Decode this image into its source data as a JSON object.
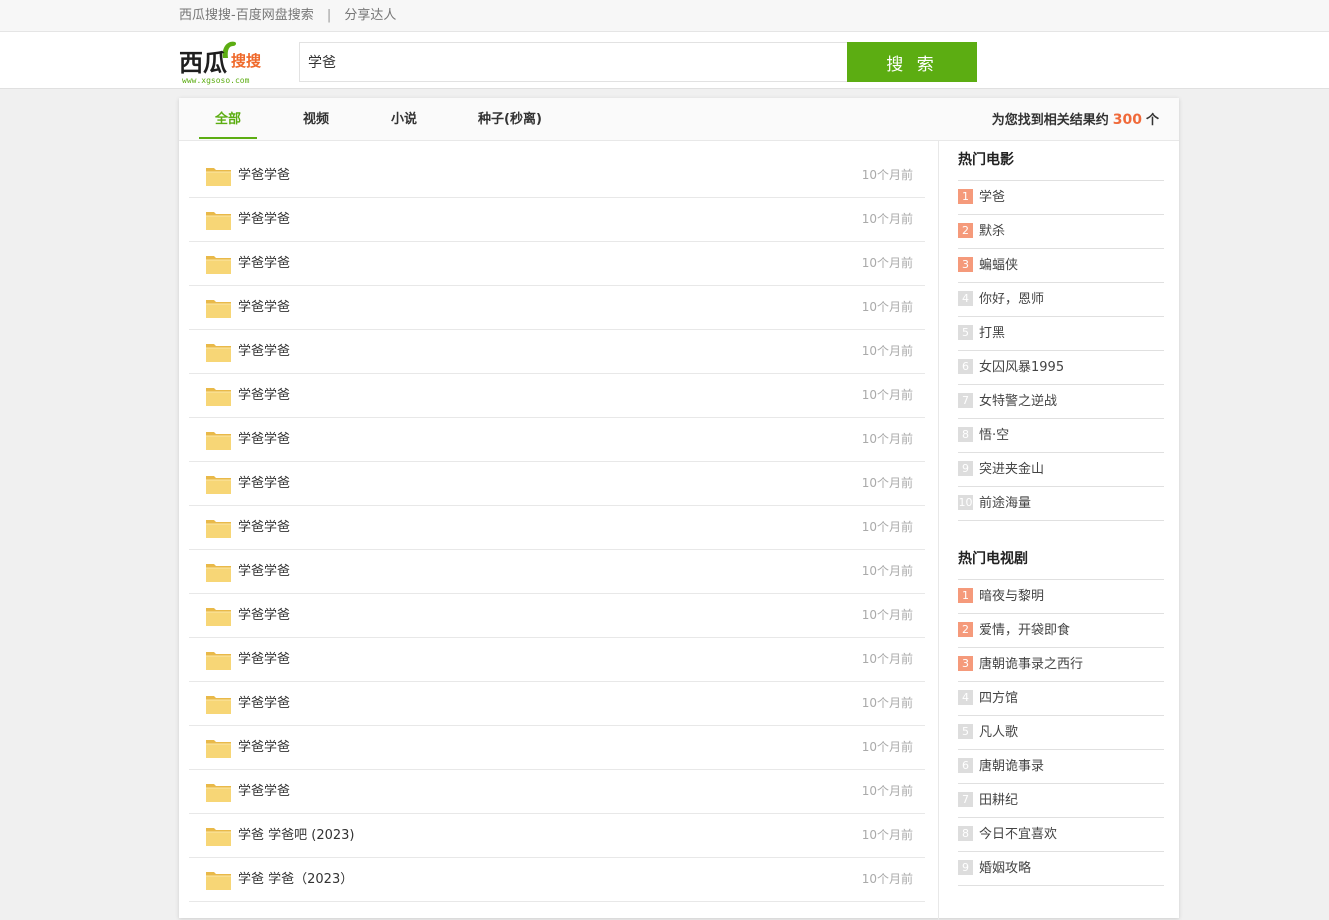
{
  "topbar": {
    "site_link": "西瓜搜搜-百度网盘搜索",
    "separator": "|",
    "share_link": "分享达人"
  },
  "logo": {
    "main_text": "西瓜",
    "sub_text": "搜搜",
    "url_text": "www.xgsoso.com"
  },
  "search": {
    "query": "学爸",
    "button_label": "搜 索"
  },
  "tabs": [
    {
      "label": "全部",
      "active": true
    },
    {
      "label": "视频",
      "active": false
    },
    {
      "label": "小说",
      "active": false
    },
    {
      "label": "种子(秒离)",
      "active": false
    }
  ],
  "result_summary": {
    "prefix": "为您找到相关结果约",
    "count": "300",
    "suffix": "个"
  },
  "results": [
    {
      "title": "学爸学爸",
      "time": "10个月前"
    },
    {
      "title": "学爸学爸",
      "time": "10个月前"
    },
    {
      "title": "学爸学爸",
      "time": "10个月前"
    },
    {
      "title": "学爸学爸",
      "time": "10个月前"
    },
    {
      "title": "学爸学爸",
      "time": "10个月前"
    },
    {
      "title": "学爸学爸",
      "time": "10个月前"
    },
    {
      "title": "学爸学爸",
      "time": "10个月前"
    },
    {
      "title": "学爸学爸",
      "time": "10个月前"
    },
    {
      "title": "学爸学爸",
      "time": "10个月前"
    },
    {
      "title": "学爸学爸",
      "time": "10个月前"
    },
    {
      "title": "学爸学爸",
      "time": "10个月前"
    },
    {
      "title": "学爸学爸",
      "time": "10个月前"
    },
    {
      "title": "学爸学爸",
      "time": "10个月前"
    },
    {
      "title": "学爸学爸",
      "time": "10个月前"
    },
    {
      "title": "学爸学爸",
      "time": "10个月前"
    },
    {
      "title": "学爸 学爸吧 (2023)",
      "time": "10个月前"
    },
    {
      "title": "学爸 学爸（2023）",
      "time": "10个月前"
    }
  ],
  "hot_movies": {
    "title": "热门电影",
    "items": [
      "学爸",
      "默杀",
      "蝙蝠侠",
      "你好，恩师",
      "打黑",
      "女囚风暴1995",
      "女特警之逆战",
      "悟·空",
      "突进夹金山",
      "前途海量"
    ]
  },
  "hot_tv": {
    "title": "热门电视剧",
    "items": [
      "暗夜与黎明",
      "爱情，开袋即食",
      "唐朝诡事录之西行",
      "四方馆",
      "凡人歌",
      "唐朝诡事录",
      "田耕纪",
      "今日不宜喜欢",
      "婚姻攻略"
    ]
  },
  "colors": {
    "accent_green": "#5cad12",
    "count_orange": "#f06a3a",
    "rank_hot": "#f59a7b",
    "rank_normal": "#dddddd"
  }
}
